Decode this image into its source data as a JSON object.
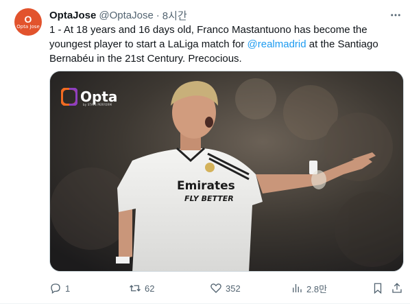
{
  "tweet": {
    "author_name": "OptaJose",
    "author_handle": "@OptaJose",
    "separator": "·",
    "time": "8시간",
    "avatar_text": "Opta Jose",
    "text_before": "1 - At 18 years and 16 days old, Franco Mastantuono has become the youngest player to start a LaLiga match for ",
    "mention": "@realmadrid",
    "text_after": " at the Santiago Bernabéu in the 21st Century. Precocious.",
    "media": {
      "logo_text": "Opta",
      "logo_subtext": "by STATS PERFORM",
      "shirt_text_1": "Emirates",
      "shirt_text_2": "FLY BETTER"
    }
  },
  "actions": {
    "replies": "1",
    "retweets": "62",
    "likes": "352",
    "views": "2.8만"
  },
  "colors": {
    "accent": "#1d9bf0",
    "text": "#0f1419",
    "muted": "#536471",
    "avatar_bg": "#e2532d",
    "opta_orange": "#f26b21",
    "opta_purple": "#8f3fbf"
  },
  "icons": [
    "more-icon",
    "reply-icon",
    "retweet-icon",
    "like-icon",
    "views-icon",
    "bookmark-icon",
    "share-icon"
  ]
}
